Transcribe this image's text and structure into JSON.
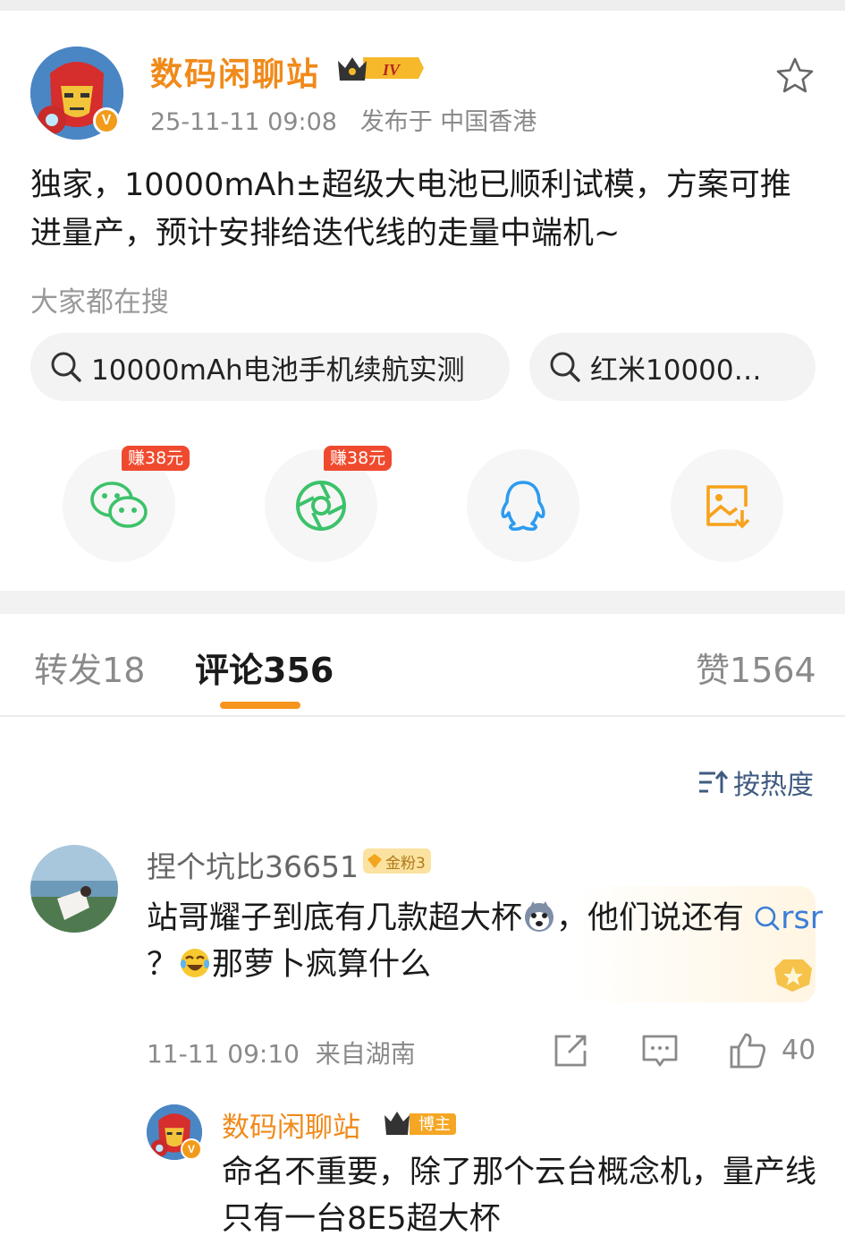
{
  "post": {
    "author_name": "数码闲聊站",
    "level_badge": "IV",
    "verified_mark": "V",
    "timestamp": "25-11-11 09:08",
    "location": "发布于 中国香港",
    "text": "独家，10000mAh±超级大电池已顺利试模，方案可推进量产，预计安排给迭代线的走量中端机~"
  },
  "search": {
    "title": "大家都在搜",
    "chips": [
      "10000mAh电池手机续航实测",
      "红米10000…"
    ]
  },
  "share": {
    "items": [
      {
        "icon": "wechat-icon",
        "tag": "赚38元"
      },
      {
        "icon": "moments-icon",
        "tag": "赚38元"
      },
      {
        "icon": "qq-icon",
        "tag": ""
      },
      {
        "icon": "save-image-icon",
        "tag": ""
      }
    ]
  },
  "tabs": {
    "repost_label": "转发",
    "repost_count": "18",
    "comment_label": "评论",
    "comment_count": "356",
    "like_label": "赞",
    "like_count": "1564",
    "active": "comments"
  },
  "sort": {
    "label": "按热度"
  },
  "comment": {
    "username": "捏个坑比36651",
    "fan_badge": "金粉3",
    "text_part1": "站哥耀子到底有几款超大杯",
    "text_part2": "，他们说还有",
    "link_text": "rsr",
    "text_part3": "？",
    "text_part4": "那萝卜疯算什么",
    "time": "11-11 09:10",
    "location": "来自湖南",
    "likes": "40"
  },
  "reply": {
    "author_name": "数码闲聊站",
    "badge_label": "博主",
    "text": "命名不重要，除了那个云台概念机，量产线只有一台8E5超大杯"
  },
  "colors": {
    "accent_orange": "#f08a1a",
    "tab_underline": "#f7941d",
    "earn_tag_red": "#f04a2e",
    "wechat_green": "#3cc26a",
    "qq_blue": "#2d9bf0",
    "link_blue": "#3b7dd8"
  }
}
